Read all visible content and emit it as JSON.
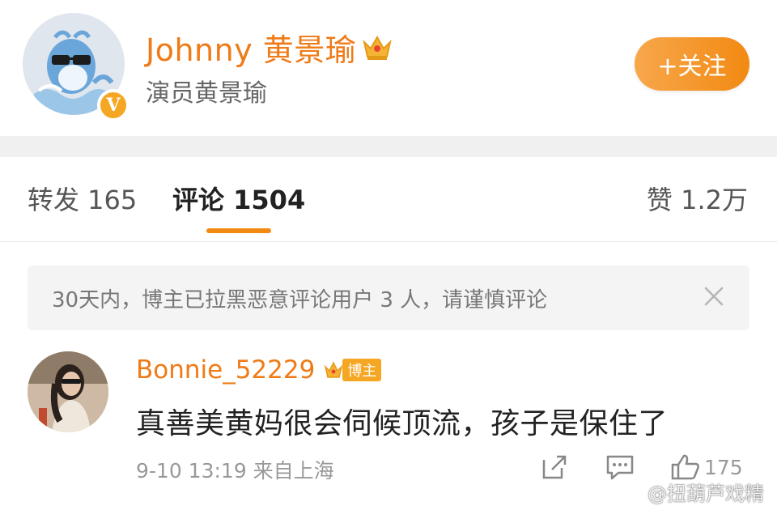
{
  "profile": {
    "name": "Johnny 黄景瑜",
    "subtitle": "演员黄景瑜",
    "verified_badge": "V",
    "follow_label": "+关注",
    "crown_icon": "crown-icon"
  },
  "tabs": {
    "reposts": "转发 165",
    "comments": "评论 1504",
    "likes": "赞 1.2万"
  },
  "notice": {
    "text": "30天内，博主已拉黑恶意评论用户 3 人，请谨慎评论",
    "close_icon": "close-icon"
  },
  "comment": {
    "username": "Bonnie_52229",
    "badge_label": "博主",
    "text": "真善美黄妈很会伺候顶流，孩子是保住了",
    "meta": "9-10 13:19  来自上海",
    "like_count": "175"
  },
  "watermark": "@扭葫芦戏精",
  "colors": {
    "accent": "#ef7b17",
    "follow_button": "#f28a12",
    "notice_bg": "#f4f4f4",
    "divider": "#f0f0f0"
  }
}
